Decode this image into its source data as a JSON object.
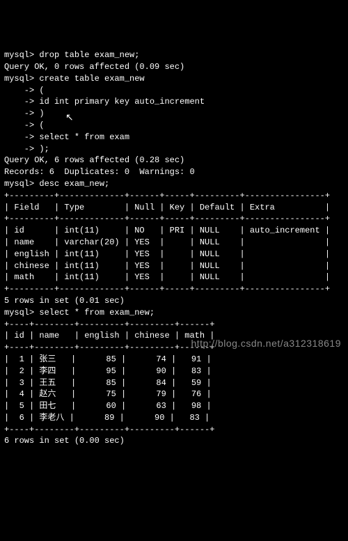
{
  "prompt": "mysql>",
  "cont": "    ->",
  "lines": {
    "l1": "mysql> drop table exam_new;",
    "l2": "Query OK, 0 rows affected (0.09 sec)",
    "blank1": "",
    "l3": "mysql> create table exam_new",
    "l4": "    -> (",
    "l5": "    -> id int primary key auto_increment",
    "l6": "    -> )",
    "l7": "    -> (",
    "l8": "    -> select * from exam",
    "l9": "    -> );",
    "l10": "Query OK, 6 rows affected (0.28 sec)",
    "l11": "Records: 6  Duplicates: 0  Warnings: 0",
    "blank2": "",
    "l12": "mysql> desc exam_new;",
    "sep1": "+---------+-------------+------+-----+---------+----------------+",
    "hdr1": "| Field   | Type        | Null | Key | Default | Extra          |",
    "sep2": "+---------+-------------+------+-----+---------+----------------+",
    "r1": "| id      | int(11)     | NO   | PRI | NULL    | auto_increment |",
    "r2": "| name    | varchar(20) | YES  |     | NULL    |                |",
    "r3": "| english | int(11)     | YES  |     | NULL    |                |",
    "r4": "| chinese | int(11)     | YES  |     | NULL    |                |",
    "r5": "| math    | int(11)     | YES  |     | NULL    |                |",
    "sep3": "+---------+-------------+------+-----+---------+----------------+",
    "l13": "5 rows in set (0.01 sec)",
    "blank3": "",
    "l14": "mysql> select * from exam_new;",
    "sep4": "+----+--------+---------+---------+------+",
    "hdr2": "| id | name   | english | chinese | math |",
    "sep5": "+----+--------+---------+---------+------+",
    "d1": "|  1 | 张三   |      85 |      74 |   91 |",
    "d2": "|  2 | 李四   |      95 |      90 |   83 |",
    "d3": "|  3 | 王五   |      85 |      84 |   59 |",
    "d4": "|  4 | 赵六   |      75 |      79 |   76 |",
    "d5": "|  5 | 田七   |      60 |      63 |   98 |",
    "d6": "|  6 | 李老八 |      89 |      90 |   83 |",
    "sep6": "+----+--------+---------+---------+------+",
    "l15": "6 rows in set (0.00 sec)"
  },
  "watermark": "http://blog.csdn.net/a312318619",
  "cursor_glyph": "↖",
  "desc_table": {
    "columns": [
      "Field",
      "Type",
      "Null",
      "Key",
      "Default",
      "Extra"
    ],
    "rows": [
      {
        "Field": "id",
        "Type": "int(11)",
        "Null": "NO",
        "Key": "PRI",
        "Default": "NULL",
        "Extra": "auto_increment"
      },
      {
        "Field": "name",
        "Type": "varchar(20)",
        "Null": "YES",
        "Key": "",
        "Default": "NULL",
        "Extra": ""
      },
      {
        "Field": "english",
        "Type": "int(11)",
        "Null": "YES",
        "Key": "",
        "Default": "NULL",
        "Extra": ""
      },
      {
        "Field": "chinese",
        "Type": "int(11)",
        "Null": "YES",
        "Key": "",
        "Default": "NULL",
        "Extra": ""
      },
      {
        "Field": "math",
        "Type": "int(11)",
        "Null": "YES",
        "Key": "",
        "Default": "NULL",
        "Extra": ""
      }
    ]
  },
  "data_table": {
    "columns": [
      "id",
      "name",
      "english",
      "chinese",
      "math"
    ],
    "rows": [
      {
        "id": 1,
        "name": "张三",
        "english": 85,
        "chinese": 74,
        "math": 91
      },
      {
        "id": 2,
        "name": "李四",
        "english": 95,
        "chinese": 90,
        "math": 83
      },
      {
        "id": 3,
        "name": "王五",
        "english": 85,
        "chinese": 84,
        "math": 59
      },
      {
        "id": 4,
        "name": "赵六",
        "english": 75,
        "chinese": 79,
        "math": 76
      },
      {
        "id": 5,
        "name": "田七",
        "english": 60,
        "chinese": 63,
        "math": 98
      },
      {
        "id": 6,
        "name": "李老八",
        "english": 89,
        "chinese": 90,
        "math": 83
      }
    ]
  }
}
